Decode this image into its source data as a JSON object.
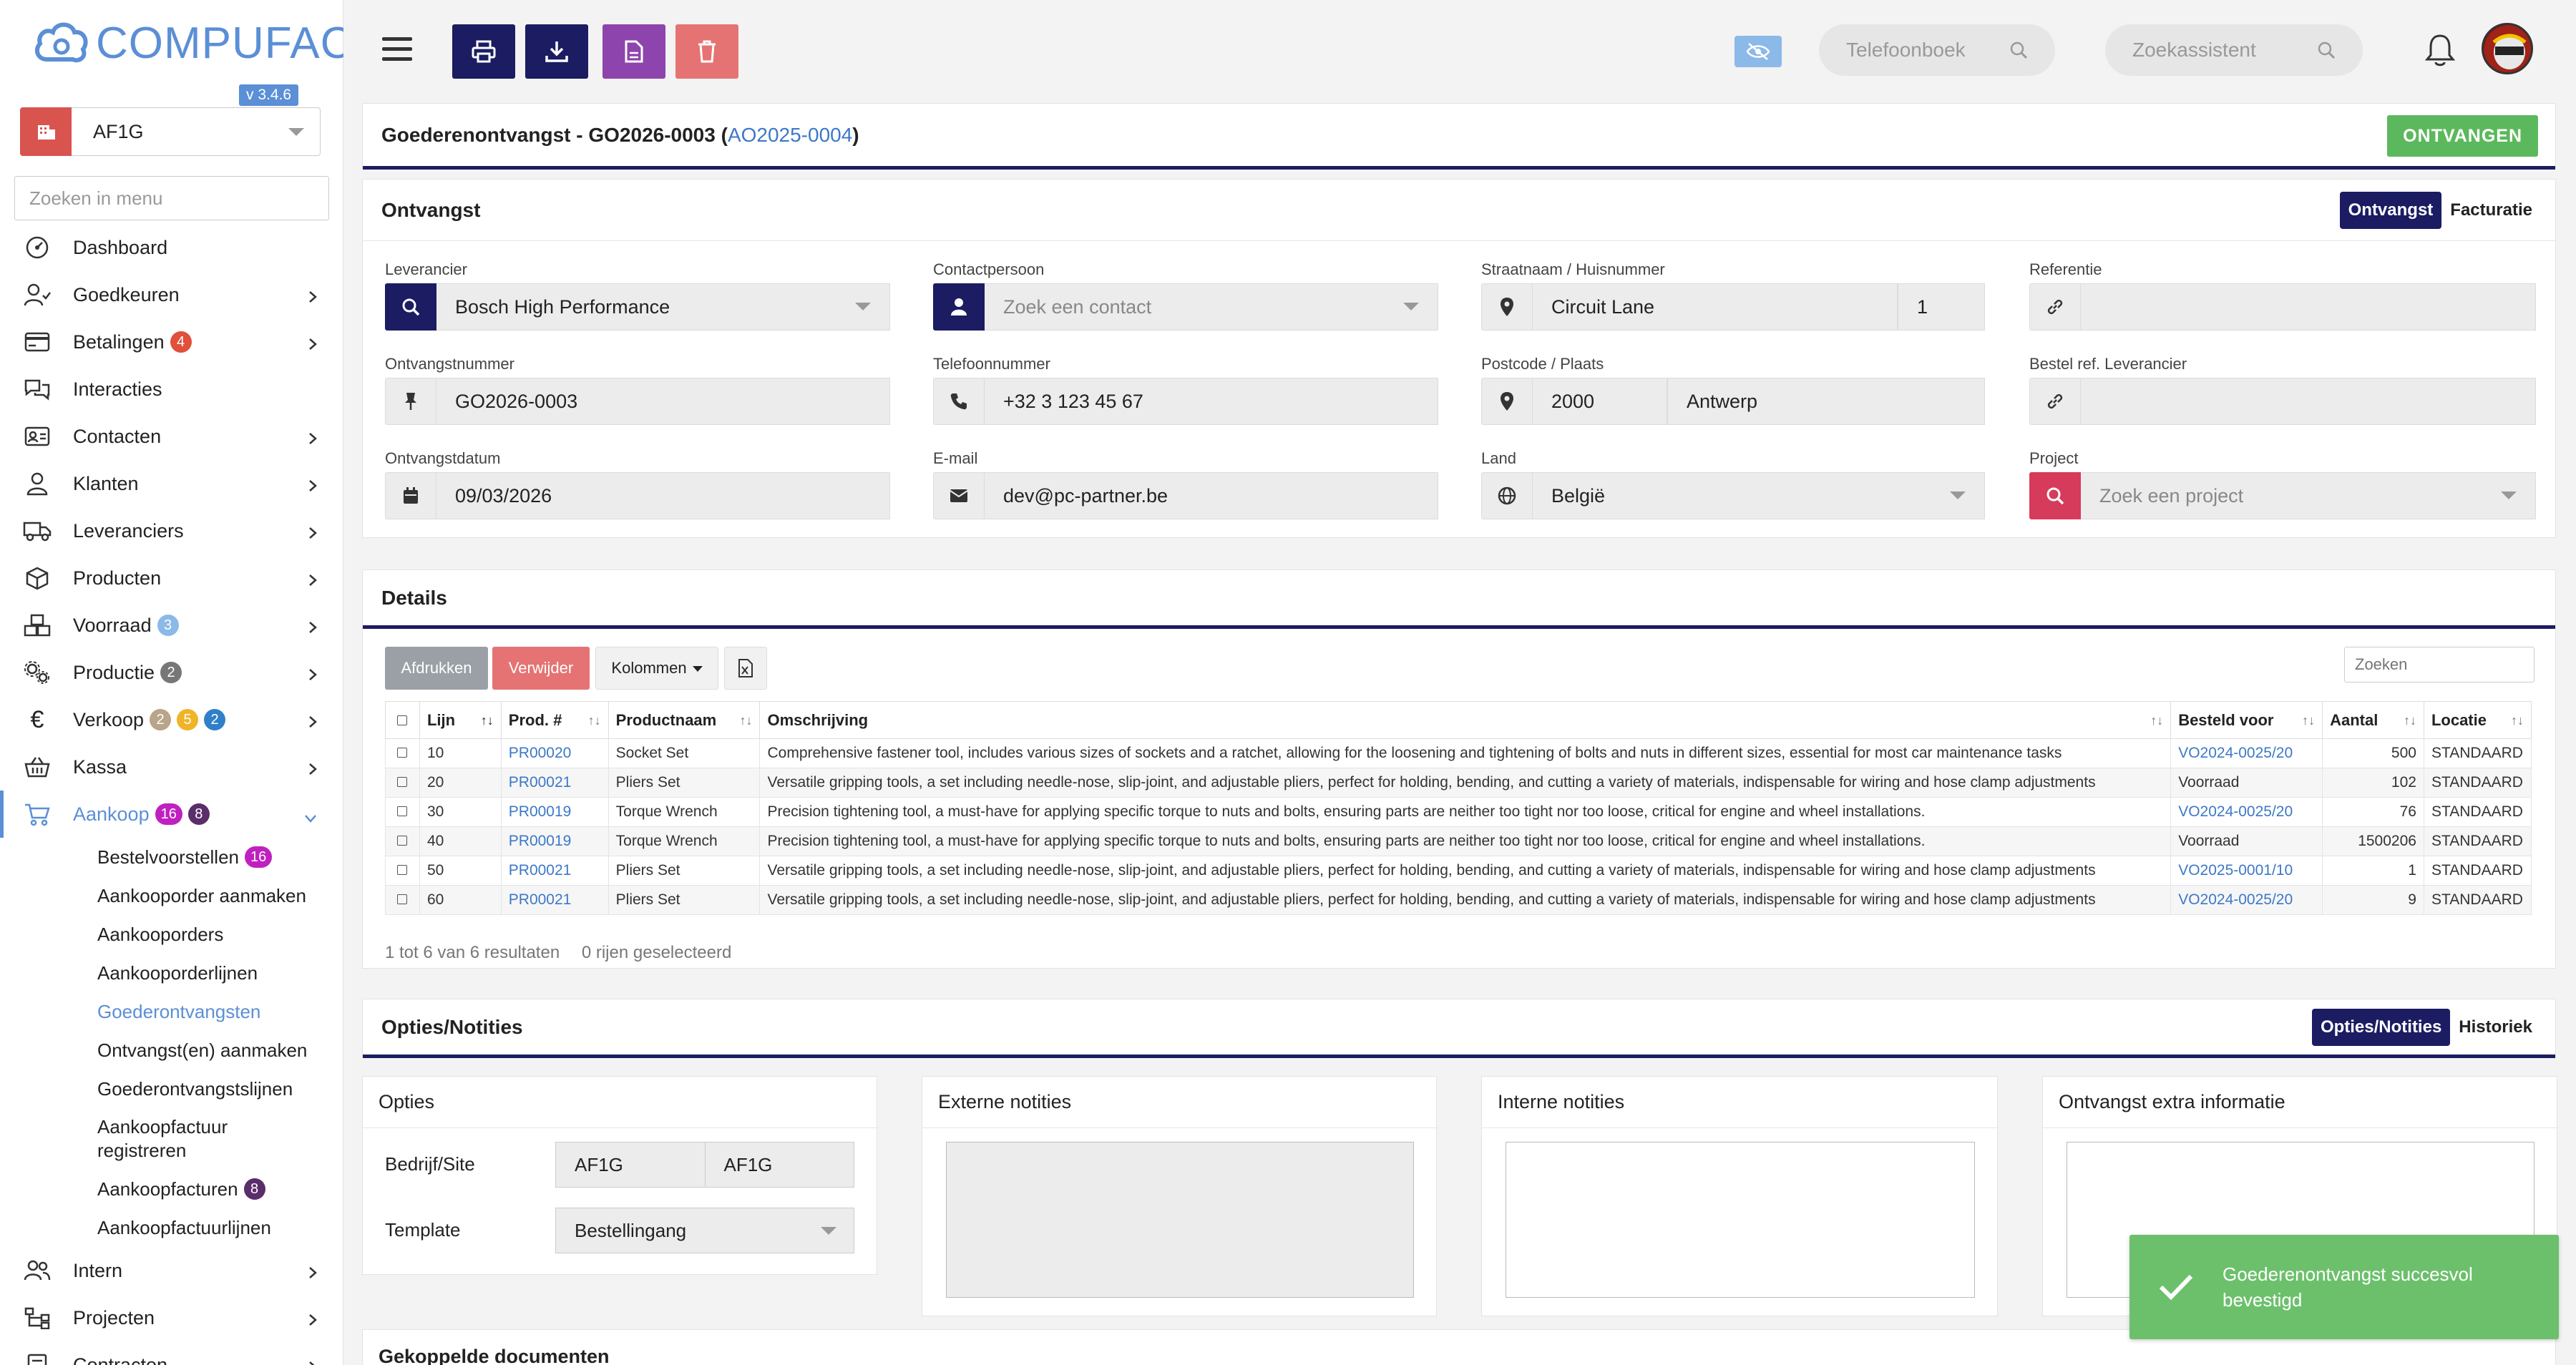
{
  "brand": {
    "name": "COMPUFACT",
    "version": "v 3.4.6",
    "accent": "#5b8fd6"
  },
  "company_selector": {
    "value": "AF1G"
  },
  "sidebar_search": {
    "placeholder": "Zoeken in menu"
  },
  "menu": {
    "dashboard": "Dashboard",
    "goedkeuren": "Goedkeuren",
    "betalingen": "Betalingen",
    "betalingen_badge": "4",
    "interacties": "Interacties",
    "contacten": "Contacten",
    "klanten": "Klanten",
    "leveranciers": "Leveranciers",
    "producten": "Producten",
    "voorraad": "Voorraad",
    "voorraad_badge": "3",
    "productie": "Productie",
    "productie_badge": "2",
    "verkoop": "Verkoop",
    "verkoop_badges": [
      "2",
      "5",
      "2"
    ],
    "kassa": "Kassa",
    "aankoop": "Aankoop",
    "aankoop_badges": [
      "16",
      "8"
    ],
    "intern": "Intern",
    "projecten": "Projecten",
    "contracten": "Contracten"
  },
  "submenu": {
    "bestelvoorstellen": "Bestelvoorstellen",
    "bestelvoorstellen_badge": "16",
    "aankooporder_aanmaken": "Aankooporder aanmaken",
    "aankooporders": "Aankooporders",
    "aankooporderlijnen": "Aankooporderlijnen",
    "goederontvangsten": "Goederontvangsten",
    "ontvangsten_aanmaken": "Ontvangst(en) aanmaken",
    "goederontvangstslijnen": "Goederontvangstslijnen",
    "aankoopfactuur_registreren_1": "Aankoopfactuur",
    "aankoopfactuur_registreren_2": "registreren",
    "aankoopfacturen": "Aankoopfacturen",
    "aankoopfacturen_badge": "8",
    "aankoopfactuurlijnen": "Aankoopfactuurlijnen"
  },
  "topbar": {
    "search1_placeholder": "Telefoonboek",
    "search2_placeholder": "Zoekassistent"
  },
  "page": {
    "title_prefix": "Goederenontvangst - GO2026-0003 (",
    "title_link": "AO2025-0004",
    "title_suffix": ")",
    "receive_button": "ONTVANGEN"
  },
  "ontvangst": {
    "title": "Ontvangst",
    "tabs": [
      "Ontvangst",
      "Facturatie"
    ],
    "leverancier_label": "Leverancier",
    "leverancier_value": "Bosch High Performance",
    "contact_label": "Contactpersoon",
    "contact_placeholder": "Zoek een contact",
    "straat_label": "Straatnaam / Huisnummer",
    "straat_value": "Circuit Lane",
    "huisnummer_value": "1",
    "referentie_label": "Referentie",
    "referentie_value": "",
    "ontvangstnummer_label": "Ontvangstnummer",
    "ontvangstnummer_value": "GO2026-0003",
    "telefoon_label": "Telefoonnummer",
    "telefoon_value": "+32 3 123 45 67",
    "postcode_label": "Postcode / Plaats",
    "postcode_value": "2000",
    "plaats_value": "Antwerp",
    "bestelref_label": "Bestel ref. Leverancier",
    "bestelref_value": "",
    "datum_label": "Ontvangstdatum",
    "datum_value": "09/03/2026",
    "email_label": "E-mail",
    "email_value": "dev@pc-partner.be",
    "land_label": "Land",
    "land_value": "België",
    "project_label": "Project",
    "project_placeholder": "Zoek een project"
  },
  "details": {
    "title": "Details",
    "btn_print": "Afdrukken",
    "btn_delete": "Verwijder",
    "btn_columns": "Kolommen",
    "search_placeholder": "Zoeken",
    "columns": [
      "Lijn",
      "Prod. #",
      "Productnaam",
      "Omschrijving",
      "Besteld voor",
      "Aantal",
      "Locatie"
    ],
    "rows": [
      {
        "lijn": "10",
        "prod": "PR00020",
        "naam": "Socket Set",
        "omschrijving": "Comprehensive fastener tool, includes various sizes of sockets and a ratchet, allowing for the loosening and tightening of bolts and nuts in different sizes, essential for most car maintenance tasks",
        "besteld": "VO2024-0025/20",
        "aantal": "500",
        "locatie": "STANDAARD"
      },
      {
        "lijn": "20",
        "prod": "PR00021",
        "naam": "Pliers Set",
        "omschrijving": "Versatile gripping tools, a set including needle-nose, slip-joint, and adjustable pliers, perfect for holding, bending, and cutting a variety of materials, indispensable for wiring and hose clamp adjustments",
        "besteld": "Voorraad",
        "aantal": "102",
        "locatie": "STANDAARD"
      },
      {
        "lijn": "30",
        "prod": "PR00019",
        "naam": "Torque Wrench",
        "omschrijving": "Precision tightening tool, a must-have for applying specific torque to nuts and bolts, ensuring parts are neither too tight nor too loose, critical for engine and wheel installations.",
        "besteld": "VO2024-0025/20",
        "aantal": "76",
        "locatie": "STANDAARD"
      },
      {
        "lijn": "40",
        "prod": "PR00019",
        "naam": "Torque Wrench",
        "omschrijving": "Precision tightening tool, a must-have for applying specific torque to nuts and bolts, ensuring parts are neither too tight nor too loose, critical for engine and wheel installations.",
        "besteld": "Voorraad",
        "aantal": "1500206",
        "locatie": "STANDAARD"
      },
      {
        "lijn": "50",
        "prod": "PR00021",
        "naam": "Pliers Set",
        "omschrijving": "Versatile gripping tools, a set including needle-nose, slip-joint, and adjustable pliers, perfect for holding, bending, and cutting a variety of materials, indispensable for wiring and hose clamp adjustments",
        "besteld": "VO2025-0001/10",
        "aantal": "1",
        "locatie": "STANDAARD"
      },
      {
        "lijn": "60",
        "prod": "PR00021",
        "naam": "Pliers Set",
        "omschrijving": "Versatile gripping tools, a set including needle-nose, slip-joint, and adjustable pliers, perfect for holding, bending, and cutting a variety of materials, indispensable for wiring and hose clamp adjustments",
        "besteld": "VO2024-0025/20",
        "aantal": "9",
        "locatie": "STANDAARD"
      }
    ],
    "footer_results": "1 tot 6 van 6 resultaten",
    "footer_selected": "0 rijen geselecteerd"
  },
  "opties": {
    "title": "Opties/Notities",
    "tabs": [
      "Opties/Notities",
      "Historiek"
    ],
    "opties_title": "Opties",
    "bedrijf_label": "Bedrijf/Site",
    "bedrijf_value1": "AF1G",
    "bedrijf_value2": "AF1G",
    "template_label": "Template",
    "template_value": "Bestellingang",
    "externe_title": "Externe notities",
    "interne_title": "Interne notities",
    "extra_title": "Ontvangst extra informatie"
  },
  "gekoppelde": {
    "title": "Gekoppelde documenten"
  },
  "toast": {
    "line1": "Goederenontvangst succesvol",
    "line2": "bevestigd"
  },
  "colors": {
    "navy": "#1c1c63",
    "purple": "#8e44ad",
    "red": "#e57373",
    "green": "#5cb85c",
    "badge_pink": "#c020c0"
  }
}
